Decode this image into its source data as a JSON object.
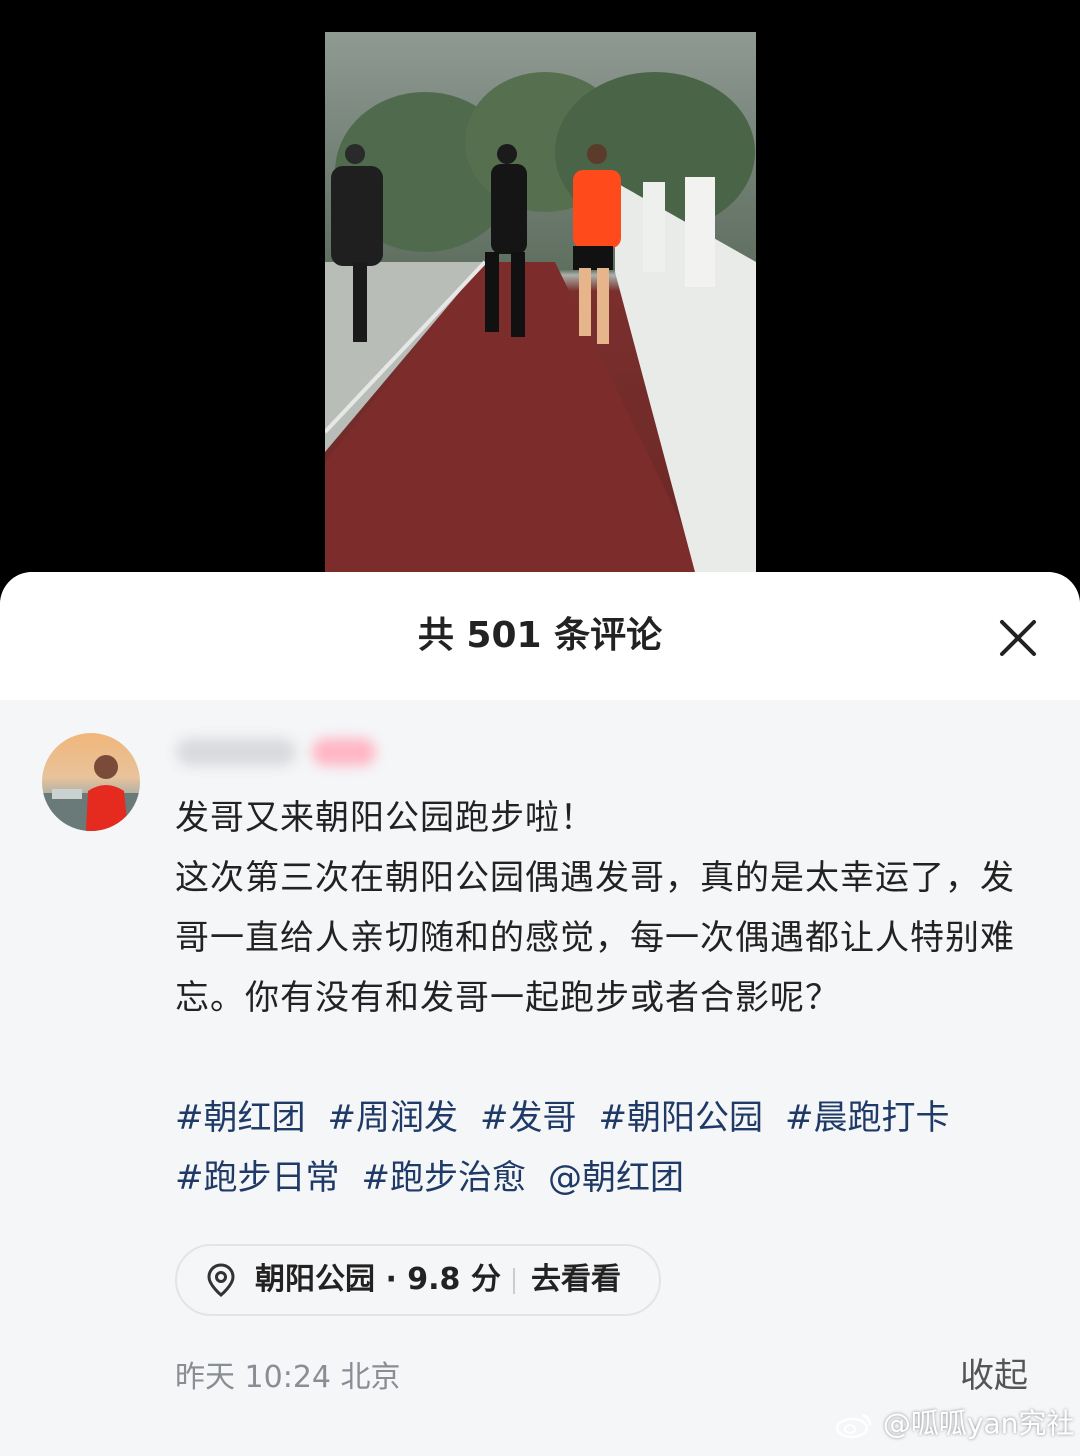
{
  "video": {
    "description_icon": "video-frame"
  },
  "comments_sheet": {
    "title": "共 501 条评论",
    "close_icon": "close-icon"
  },
  "post": {
    "author_name": "",
    "author_badge": "",
    "paragraph_1": "发哥又来朝阳公园跑步啦！",
    "paragraph_2": "这次第三次在朝阳公园偶遇发哥，真的是太幸运了，发哥一直给人亲切随和的感觉，每一次偶遇都让人特别难忘。你有没有和发哥一起跑步或者合影呢？",
    "tags": [
      "#朝红团",
      "#周润发",
      "#发哥",
      "#朝阳公园",
      "#晨跑打卡",
      "#跑步日常",
      "#跑步治愈",
      "@朝红团"
    ],
    "location": {
      "name": "朝阳公园 · 9.8 分",
      "action": "去看看"
    },
    "meta": "昨天 10:24 北京",
    "collapse_label": "收起"
  },
  "watermark": "@呱呱yan究社",
  "colors": {
    "tag": "#1f3a66",
    "sheet_bg": "#f5f6f8",
    "meta": "#8a8d93"
  }
}
